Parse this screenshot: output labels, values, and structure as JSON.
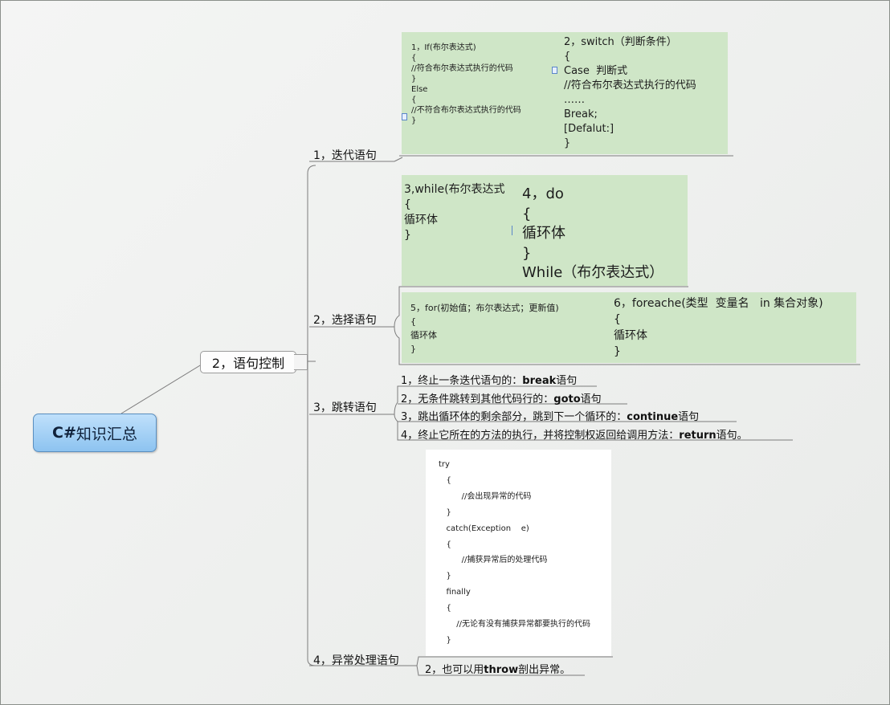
{
  "root": {
    "bold": "C#",
    "rest": "知识汇总"
  },
  "main": "2，语句控制",
  "branches": {
    "b1": "1，迭代语句",
    "b2": "2，选择语句",
    "b3": "3，跳转语句",
    "b4": "4，异常处理语句"
  },
  "notes": {
    "if_code": "1，If(布尔表达式)\n{\n//符合布尔表达式执行的代码\n}\nElse\n{\n//不符合布尔表达式执行的代码\n}",
    "switch_code": "2，switch（判断条件）\n{\nCase  判断式\n//符合布尔表达式执行的代码\n……\nBreak;\n[Defalut:]\n}",
    "while_code": "3,while(布尔表达式\n{\n循环体\n}",
    "do_code": "4，do\n{\n循环体\n}\nWhile（布尔表达式）",
    "for_code": "5，for(初始值；布尔表达式；更新值)\n{\n循环体\n}",
    "foreach_code": "6，foreache(类型  变量名   in 集合对象)\n{\n循环体\n}",
    "try_code": "try\n   {\n         //会出现异常的代码\n   }\n   catch(Exception    e)\n   {\n         //捕获异常后的处理代码\n   }\n   finally\n   {\n       //无论有没有捕获异常都要执行的代码\n   }"
  },
  "jumps": [
    {
      "pre": "1，终止一条迭代语句的：",
      "kw": "break",
      "post": "语句"
    },
    {
      "pre": "2，无条件跳转到其他代码行的：",
      "kw": "goto",
      "post": "语句"
    },
    {
      "pre": "3，跳出循环体的剩余部分，跳到下一个循环的：",
      "kw": "continue",
      "post": "语句"
    },
    {
      "pre": "4，终止它所在的方法的执行，并将控制权返回给调用方法：",
      "kw": "return",
      "post": "语句。"
    }
  ],
  "throw_note": {
    "pre": "2，也可以用",
    "kw": "throw",
    "post": "剖出异常。"
  }
}
